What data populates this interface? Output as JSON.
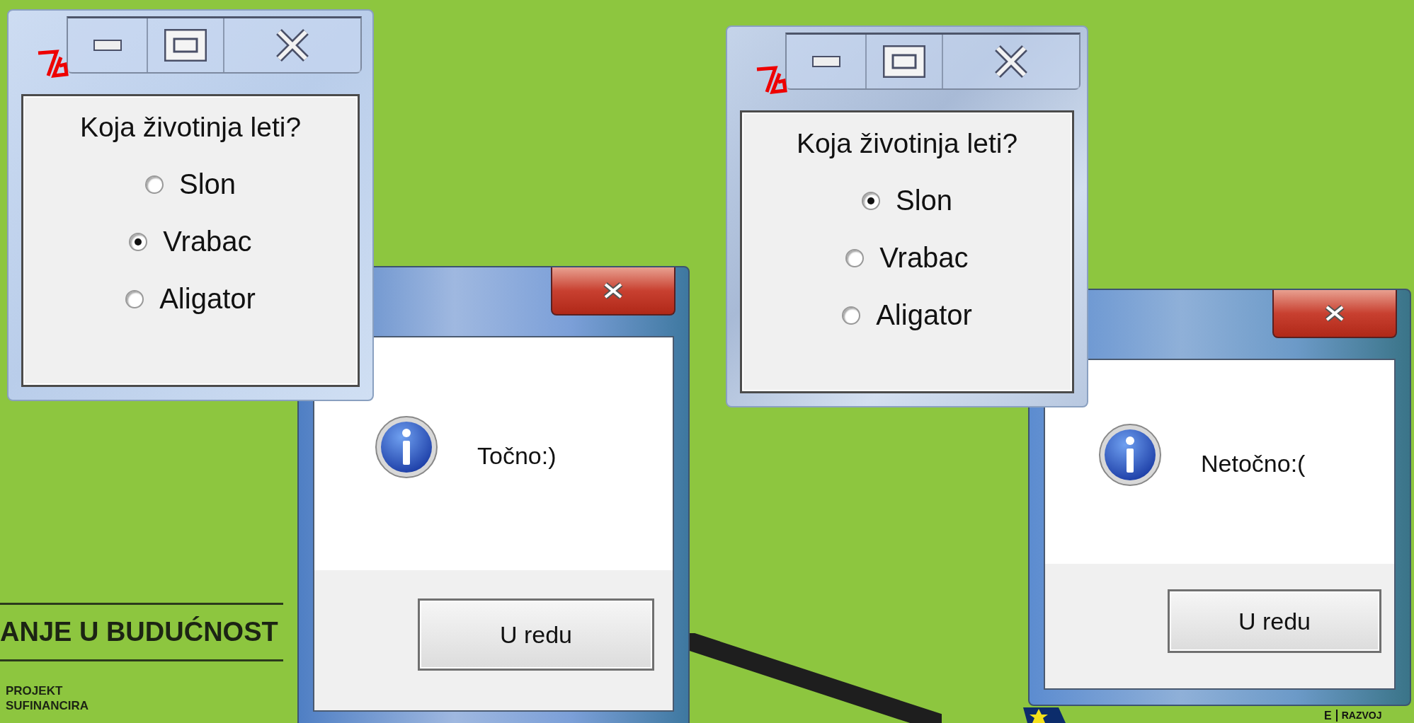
{
  "background": {
    "banner": "ANJE U BUDUĆNOST",
    "lines": [
      "PROJEKT",
      "SUFINANCIRA"
    ],
    "logo_letter": "E",
    "logo_word": "RAZVOJ"
  },
  "windows": [
    {
      "question": "Koja životinja leti?",
      "options": [
        {
          "label": "Slon",
          "selected": false
        },
        {
          "label": "Vrabac",
          "selected": true
        },
        {
          "label": "Aligator",
          "selected": false
        }
      ]
    },
    {
      "question": "Koja životinja leti?",
      "options": [
        {
          "label": "Slon",
          "selected": true
        },
        {
          "label": "Vrabac",
          "selected": false
        },
        {
          "label": "Aligator",
          "selected": false
        }
      ]
    }
  ],
  "dialogs": [
    {
      "message": "Točno:)",
      "button": "U redu"
    },
    {
      "message": "Netočno:(",
      "button": "U redu"
    }
  ]
}
